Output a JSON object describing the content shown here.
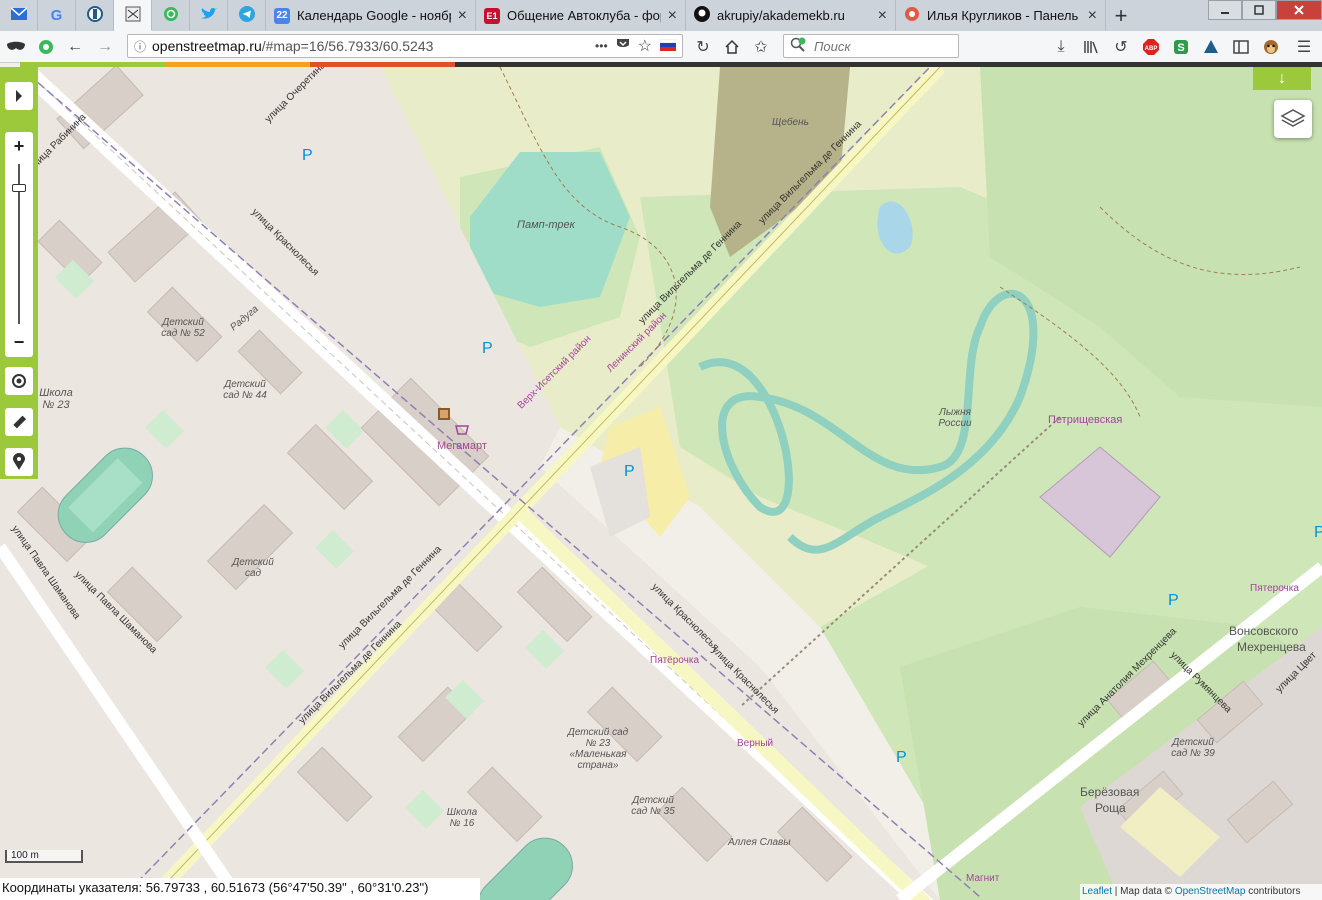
{
  "tabs": [
    {
      "title": "Календарь Google - ноябрь",
      "close": "×"
    },
    {
      "title": "Общение Автоклуба - фору",
      "close": "×"
    },
    {
      "title": "akrupiy/akademekb.ru",
      "close": "×"
    },
    {
      "title": "Илья Кругликов - Панель уп",
      "close": "×"
    }
  ],
  "tab_favicons": {
    "calendar": "22",
    "e1": "E1"
  },
  "new_tab": "+",
  "address_bar": {
    "host": "openstreetmap.ru",
    "rest": "/#map=16/56.7933/60.5243"
  },
  "search_placeholder": "Поиск",
  "address_dots": "•••",
  "map_controls": {
    "zoom_in": "+",
    "zoom_out": "−",
    "download": "↓"
  },
  "colors": {
    "accent_green": "#9cc93c",
    "progress_orange": "#f4a21b",
    "progress_red": "#e0502a"
  },
  "map_labels": {
    "pump_track": "Памп-трек",
    "gravel": "Щебень",
    "megamart": "Мегамарт",
    "district": "Верх-Исетский район",
    "district2": "Ленинский район",
    "ski_russia": "Лыжня России",
    "petrishchevskaya": "Петрищевская",
    "pyaterochka": "Пятерочка",
    "pyaterochka2": "Пятёрочка",
    "vernyi": "Верный",
    "magnit": "Магнит",
    "vonsovskogo": "Вонсовского",
    "mekhrentseva": "Мехренцева",
    "berezovaya": "Берёзовая",
    "roshcha": "Роща",
    "kindergarten52": "Детский сад № 52",
    "kindergarten44": "Детский сад № 44",
    "kindergarten": "Детский сад",
    "kindergarten23": "Детский сад № 23 «Маленькая страна»",
    "kindergarten35": "Детский сад № 35",
    "kindergarten39": "Детский сад № 39",
    "school23": "Школа № 23",
    "school16": "Школа № 16",
    "raduga": "Радуга",
    "alley": "Аллея Славы",
    "parking": "P"
  },
  "street_labels": {
    "krasnolesya": "улица Краснолесья",
    "de_gennina": "улица Вильгельма де Геннина",
    "shamanova": "улица Павла Шаманова",
    "rabinina": "улица Рабинина",
    "ocheretina": "улица Очеретина",
    "mekhrentseva": "улица Анатолия Мехренцева",
    "rumyantsev": "улица Румянцева",
    "tsvetaevoy": "улица Цвет"
  },
  "scale_label": "100 m",
  "coordinates": "Координаты указателя: 56.79733 , 60.51673 (56°47'50.39\" , 60°31'0.23\")",
  "attribution": {
    "leaflet": "Leaflet",
    "sep": " | Map data © ",
    "osm": "OpenStreetMap",
    "contrib": " contributors"
  }
}
